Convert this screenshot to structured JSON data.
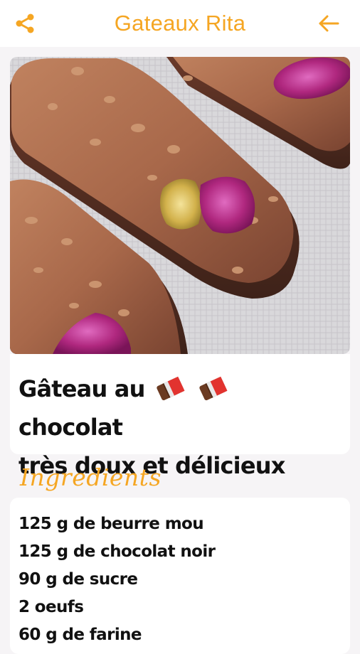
{
  "header": {
    "title": "Gateaux Rita",
    "share_icon": "share-icon",
    "back_icon": "arrow-back-icon",
    "accent_color": "#f5a623"
  },
  "recipe": {
    "title_part1": "Gâteau au",
    "title_part2": "chocolat",
    "title_line2": "très doux et délicieux",
    "title_emoji": "chocolate-bar-emoji"
  },
  "ingredients": {
    "heading": "Ingredients",
    "items": [
      "125 g de beurre mou",
      "125 g de chocolat noir",
      "90 g de sucre",
      "2 oeufs",
      "60 g de farine"
    ]
  }
}
